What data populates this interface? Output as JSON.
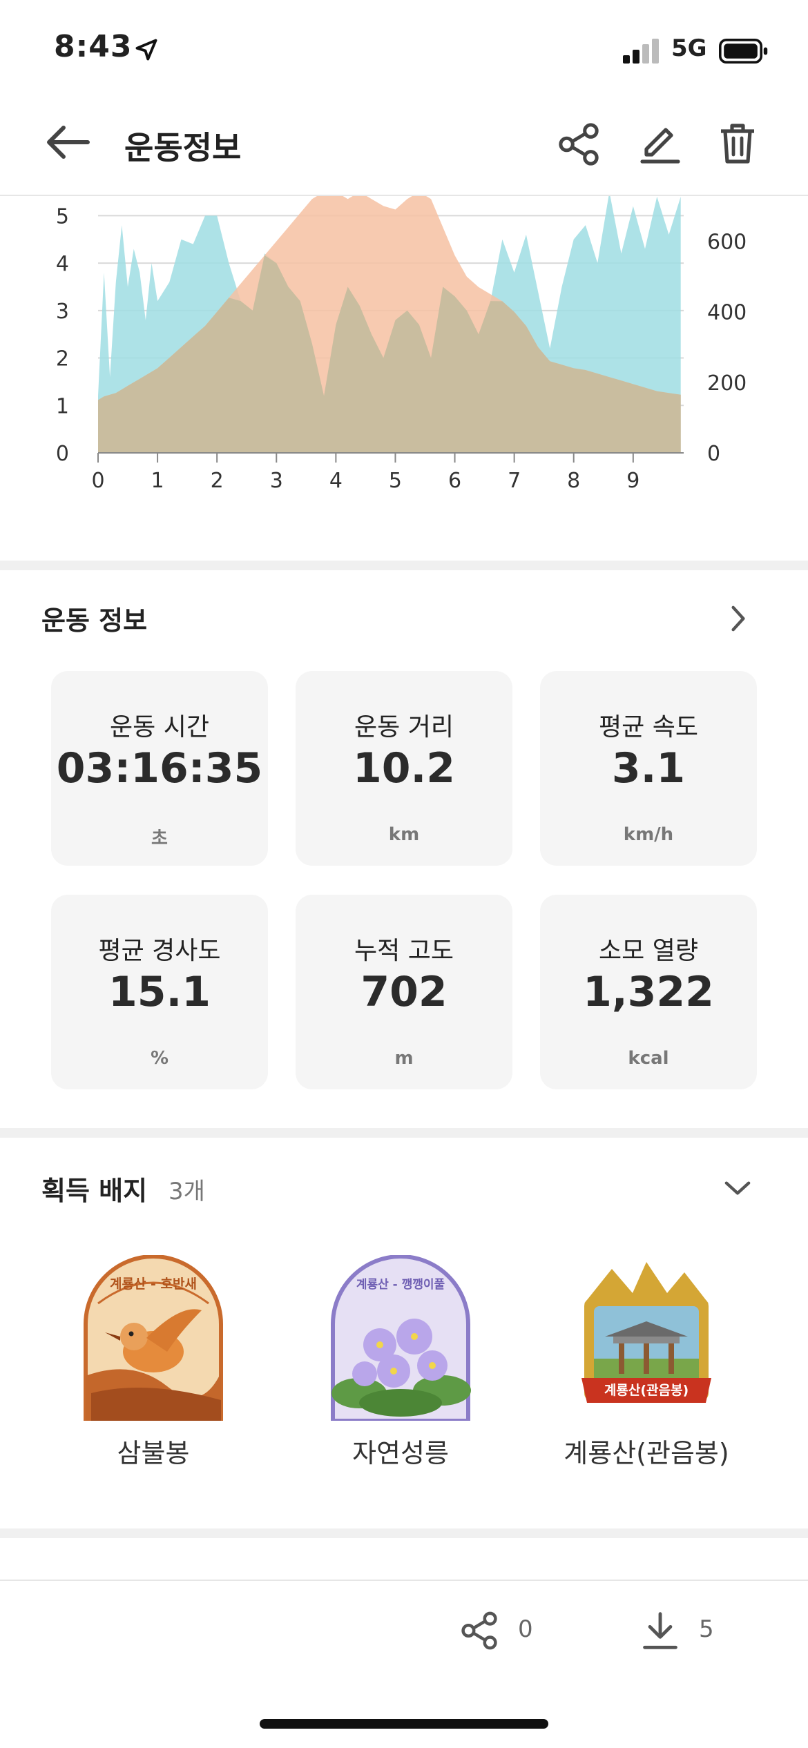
{
  "status": {
    "time": "8:43",
    "network": "5G"
  },
  "header": {
    "title": "운동정보"
  },
  "chart_data": {
    "type": "area",
    "x": [
      0,
      0.1,
      0.2,
      0.3,
      0.4,
      0.5,
      0.6,
      0.7,
      0.8,
      0.9,
      1,
      1.2,
      1.4,
      1.6,
      1.8,
      2,
      2.2,
      2.4,
      2.6,
      2.8,
      3,
      3.2,
      3.4,
      3.6,
      3.8,
      4,
      4.2,
      4.4,
      4.6,
      4.8,
      5,
      5.2,
      5.4,
      5.6,
      5.8,
      6,
      6.2,
      6.4,
      6.6,
      6.8,
      7,
      7.2,
      7.4,
      7.6,
      7.8,
      8,
      8.2,
      8.4,
      8.6,
      8.8,
      9,
      9.2,
      9.4,
      9.6,
      9.8
    ],
    "x_ticks": [
      "0",
      "1",
      "2",
      "3",
      "4",
      "5",
      "6",
      "7",
      "8",
      "9"
    ],
    "y_left_ticks": [
      "0",
      "1",
      "2",
      "3",
      "4",
      "5"
    ],
    "y_right_ticks": [
      "0",
      "200",
      "400",
      "600"
    ],
    "ylim_left": [
      0,
      5.5
    ],
    "ylim_right": [
      0,
      740
    ],
    "series": [
      {
        "axis": "left",
        "color": "#9fdde3",
        "values": [
          1.2,
          3.8,
          1.6,
          3.6,
          4.8,
          3.5,
          4.3,
          3.8,
          2.8,
          4.0,
          3.2,
          3.6,
          4.5,
          4.4,
          5.0,
          5.0,
          4.0,
          3.2,
          3.0,
          4.2,
          4.0,
          3.5,
          3.2,
          2.3,
          1.2,
          2.7,
          3.5,
          3.1,
          2.5,
          2.0,
          2.8,
          3.0,
          2.7,
          2.0,
          3.5,
          3.3,
          3.0,
          2.5,
          3.2,
          4.5,
          3.8,
          4.6,
          3.4,
          2.2,
          3.5,
          4.5,
          4.8,
          4.0,
          5.5,
          4.2,
          5.2,
          4.3,
          5.4,
          4.6,
          5.4
        ]
      },
      {
        "axis": "right",
        "color": "#f6c1a2",
        "values": [
          150,
          160,
          165,
          170,
          180,
          190,
          200,
          210,
          220,
          230,
          240,
          270,
          300,
          330,
          360,
          400,
          440,
          480,
          520,
          560,
          600,
          640,
          680,
          720,
          740,
          740,
          720,
          740,
          720,
          700,
          690,
          720,
          740,
          720,
          640,
          560,
          500,
          470,
          450,
          430,
          400,
          360,
          300,
          260,
          250,
          240,
          235,
          225,
          215,
          205,
          195,
          185,
          175,
          170,
          165
        ]
      }
    ],
    "overlap_color": "#c9bd9f"
  },
  "workout": {
    "title": "운동 정보",
    "stats": [
      {
        "label": "운동 시간",
        "value": "03:16:35",
        "unit": "초"
      },
      {
        "label": "운동 거리",
        "value": "10.2",
        "unit": "km"
      },
      {
        "label": "평균 속도",
        "value": "3.1",
        "unit": "km/h"
      },
      {
        "label": "평균 경사도",
        "value": "15.1",
        "unit": "%"
      },
      {
        "label": "누적 고도",
        "value": "702",
        "unit": "m"
      },
      {
        "label": "소모 열량",
        "value": "1,322",
        "unit": "kcal"
      }
    ]
  },
  "badges": {
    "title": "획득 배지",
    "count": "3개",
    "items": [
      {
        "name": "삼불봉",
        "art_text": "계룡산 - 호반새"
      },
      {
        "name": "자연성릉",
        "art_text": "계룡산 - 깽깽이풀"
      },
      {
        "name": "계룡산(관음봉)",
        "art_text": "계룡산(관음봉)"
      }
    ]
  },
  "footer": {
    "share_count": "0",
    "download_count": "5"
  }
}
